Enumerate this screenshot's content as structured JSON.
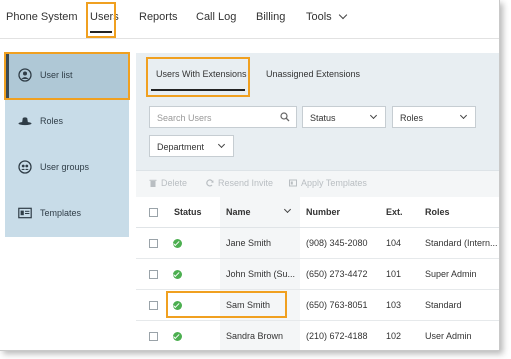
{
  "topnav": {
    "items": [
      "Phone System",
      "Users",
      "Reports",
      "Call Log",
      "Billing",
      "Tools"
    ]
  },
  "sidebar": {
    "items": [
      {
        "label": "User list",
        "icon": "user-circle-icon"
      },
      {
        "label": "Roles",
        "icon": "hat-icon"
      },
      {
        "label": "User groups",
        "icon": "users-group-icon"
      },
      {
        "label": "Templates",
        "icon": "id-card-icon"
      }
    ]
  },
  "tabs": [
    "Users With Extensions",
    "Unassigned Extensions"
  ],
  "filters": {
    "search_placeholder": "Search Users",
    "status": "Status",
    "roles": "Roles",
    "department": "Department"
  },
  "toolbar": {
    "delete": "Delete",
    "resend": "Resend Invite",
    "apply": "Apply Templates"
  },
  "table": {
    "headers": [
      "Status",
      "Name",
      "Number",
      "Ext.",
      "Roles"
    ],
    "rows": [
      {
        "name": "Jane Smith",
        "number": "(908) 345-2080",
        "ext": "104",
        "role": "Standard (Intern..."
      },
      {
        "name": "John Smith (Su...",
        "number": "(650) 273-4472",
        "ext": "101",
        "role": "Super Admin"
      },
      {
        "name": "Sam Smith",
        "number": "(650) 763-8051",
        "ext": "103",
        "role": "Standard"
      },
      {
        "name": "Sandra Brown",
        "number": "(210) 672-4188",
        "ext": "102",
        "role": "User Admin"
      }
    ]
  },
  "colors": {
    "highlight": "#f0a020",
    "sidebar": "#c8dce8",
    "status_ok": "#4caf50"
  }
}
